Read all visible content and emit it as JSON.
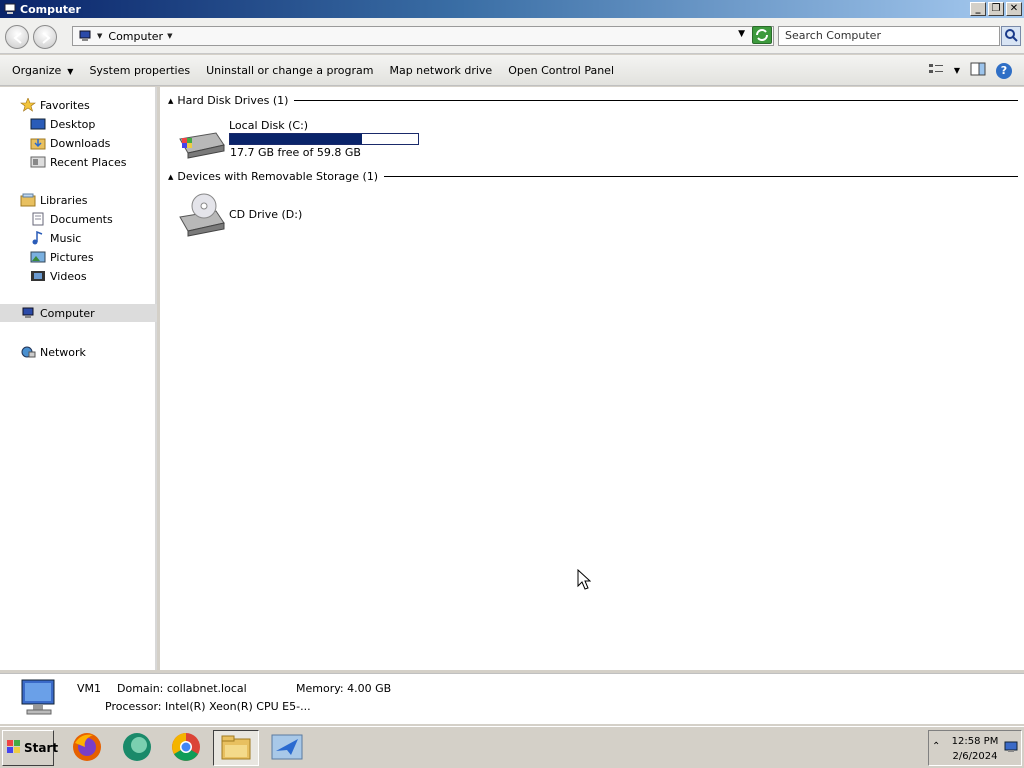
{
  "window": {
    "title": "Computer",
    "buttons": [
      "_",
      "❐",
      "✕"
    ]
  },
  "address": {
    "crumb": "Computer",
    "search_placeholder": "Search Computer"
  },
  "commands": {
    "organize": "Organize",
    "system_properties": "System properties",
    "uninstall": "Uninstall or change a program",
    "map_drive": "Map network drive",
    "control_panel": "Open Control Panel"
  },
  "nav": {
    "favorites": "Favorites",
    "desktop": "Desktop",
    "downloads": "Downloads",
    "recent": "Recent Places",
    "libraries": "Libraries",
    "documents": "Documents",
    "music": "Music",
    "pictures": "Pictures",
    "videos": "Videos",
    "computer": "Computer",
    "network": "Network"
  },
  "groups": {
    "hdd": "Hard Disk Drives (1)",
    "removable": "Devices with Removable Storage (1)"
  },
  "drives": {
    "c_name": "Local Disk (C:)",
    "c_free": "17.7 GB free of 59.8 GB",
    "c_used_fraction": 0.704,
    "d_name": "CD Drive (D:)"
  },
  "details": {
    "name": "VM1",
    "domain": "Domain: collabnet.local",
    "memory": "Memory: 4.00 GB",
    "processor": "Processor: Intel(R) Xeon(R) CPU E5-..."
  },
  "taskbar": {
    "start": "Start",
    "time": "12:58 PM",
    "date": "2/6/2024"
  }
}
